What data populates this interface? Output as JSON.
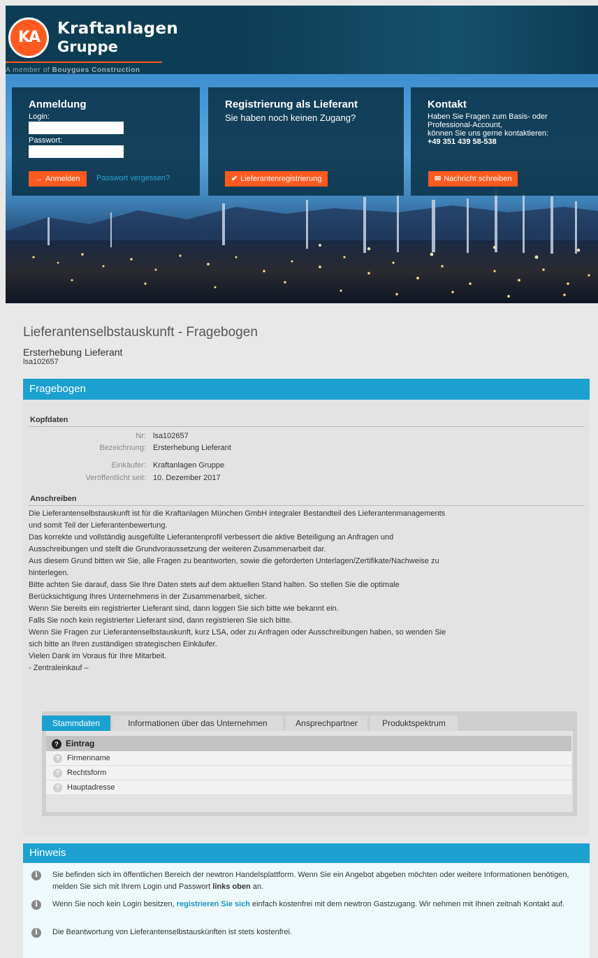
{
  "brand": {
    "logo_letters": "KA",
    "line1": "Kraftanlagen",
    "line2": "Gruppe",
    "member_prefix": "A member of ",
    "member_name": "Bouygues Construction",
    "accent": "#ff5a1f",
    "dark": "#0c3d54"
  },
  "login": {
    "title": "Anmeldung",
    "login_label": "Login:",
    "password_label": "Passwort:",
    "submit_label": "Anmelden",
    "forgot_label": "Passwort vergessen?"
  },
  "register": {
    "title": "Registrierung als Lieferant",
    "text": "Sie haben noch keinen Zugang?",
    "button_label": "Lieferantenregistrierung"
  },
  "contact": {
    "title": "Kontakt",
    "line1": "Haben Sie Fragen zum Basis- oder",
    "line2": "Professional-Account,",
    "line3": "können Sie uns gerne kontaktieren:",
    "phone": "+49 351 439 58-538",
    "button_label": "Nachricht schreiben"
  },
  "page": {
    "title": "Lieferantenselbstauskunft - Fragebogen",
    "subtitle": "Ersterhebung Lieferant",
    "id": "lsa102657"
  },
  "fragebogen": {
    "header": "Fragebogen",
    "kopfdaten_label": "Kopfdaten",
    "fields": [
      {
        "key": "Nr:",
        "value": "lsa102657"
      },
      {
        "key": "Bezeichnung:",
        "value": "Ersterhebung Lieferant"
      },
      {
        "key": "Einkäufer:",
        "value": "Kraftanlagen Gruppe"
      },
      {
        "key": "Veröffentlicht seit:",
        "value": "10. Dezember 2017"
      }
    ],
    "anschreiben_label": "Anschreiben",
    "letter": [
      "Die Lieferantenselbstauskunft ist für die Kraftanlagen München GmbH integraler Bestandteil des Lieferantenmanagements",
      "und somit Teil der Lieferantenbewertung.",
      "Das korrekte und vollständig ausgefüllte Lieferantenprofil verbessert die aktive Beteiligung an Anfragen und",
      "Ausschreibungen und stellt die Grundvoraussetzung der weiteren Zusammenarbeit dar.",
      "Aus diesem Grund bitten wir Sie, alle Fragen zu beantworten, sowie die geforderten Unterlagen/Zertifikate/Nachweise zu",
      "hinterlegen.",
      "Bitte achten Sie darauf, dass Sie Ihre Daten stets auf dem aktuellen Stand halten. So stellen Sie die optimale",
      "Berücksichtigung Ihres Unternehmens in der Zusammenarbeit, sicher.",
      "Wenn Sie bereits ein registrierter Lieferant sind, dann loggen Sie sich bitte wie bekannt ein.",
      "Falls Sie noch kein registrierter Lieferant sind, dann registrieren Sie sich bitte.",
      "Wenn Sie Fragen zur Lieferantenselbstauskunft, kurz LSA, oder zu Anfragen oder Ausschreibungen haben, so wenden Sie",
      "sich bitte an Ihren zuständigen strategischen Einkäufer.",
      "Vielen Dank im Voraus für Ihre Mitarbeit.",
      "- Zentraleinkauf –"
    ],
    "tabs": [
      {
        "label": "Stammdaten"
      },
      {
        "label": "Informationen über das Unternehmen"
      },
      {
        "label": "Ansprechpartner"
      },
      {
        "label": "Produktspektrum"
      }
    ],
    "table_header": "Eintrag",
    "rows": [
      "Firmenname",
      "Rechtsform",
      "Hauptadresse"
    ]
  },
  "hinweis": {
    "header": "Hinweis",
    "hint1_a": "Sie befinden sich im öffentlichen Bereich der newtron Handelsplattform. Wenn Sie ein Angebot abgeben möchten oder weitere Informationen benötigen, melden Sie sich mit Ihrem Login und Passwort ",
    "hint1_b": "links oben",
    "hint1_c": " an.",
    "hint2_a": "Wenn Sie noch kein Login besitzen, ",
    "hint2_b": "registrieren Sie sich",
    "hint2_c": " einfach kostenfrei mit dem newtron Gastzugang. Wir nehmen mit Ihnen zeitnah Kontakt auf.",
    "hint3": "Die Beantwortung von Lieferantenselbstauskünften ist stets kostenfrei."
  }
}
